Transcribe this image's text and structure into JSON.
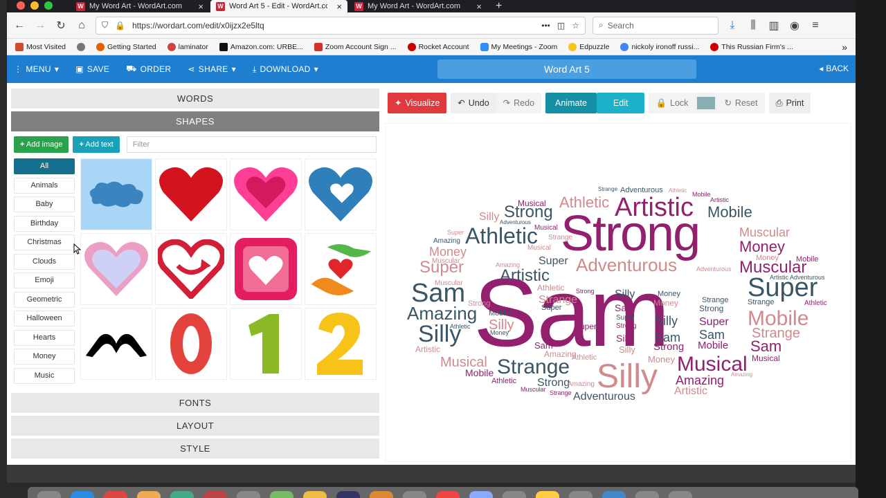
{
  "browser": {
    "tabs": [
      {
        "title": "My Word Art - WordArt.com"
      },
      {
        "title": "Word Art 5 - Edit - WordArt.co"
      },
      {
        "title": "My Word Art - WordArt.com"
      }
    ],
    "url": "https://wordart.com/edit/x0ijzx2e5ltq",
    "search_placeholder": "Search",
    "bookmarks": [
      "Most Visited",
      "Getting Started",
      "laminator",
      "Amazon.com: URBE...",
      "Zoom Account Sign ...",
      "Rocket Account",
      "My Meetings - Zoom",
      "Edpuzzle",
      "nickoly ironoff russi...",
      "This Russian Firm's ..."
    ]
  },
  "toolbar": {
    "menu": "MENU",
    "save": "SAVE",
    "order": "ORDER",
    "share": "SHARE",
    "download": "DOWNLOAD",
    "title": "Word Art 5",
    "back": "BACK"
  },
  "left": {
    "words": "WORDS",
    "shapes": "SHAPES",
    "add_image": "Add image",
    "add_text": "Add text",
    "filter_placeholder": "Filter",
    "categories": [
      "All",
      "Animals",
      "Baby",
      "Birthday",
      "Christmas",
      "Clouds",
      "Emoji",
      "Geometric",
      "Halloween",
      "Hearts",
      "Money",
      "Music"
    ],
    "fonts": "FONTS",
    "layout": "LAYOUT",
    "style": "STYLE"
  },
  "right": {
    "visualize": "Visualize",
    "undo": "Undo",
    "redo": "Redo",
    "animate": "Animate",
    "edit": "Edit",
    "lock": "Lock",
    "reset": "Reset",
    "print": "Print",
    "swatch_color": "#87aeb3"
  },
  "colors": {
    "accent": "#1e7fd0",
    "purple": "#92206e",
    "slate": "#3a5566",
    "pink": "#d08a8d"
  },
  "wordcloud": [
    [
      "Sam",
      684,
      500,
      140,
      "purple"
    ],
    [
      "Strong",
      810,
      362,
      72,
      "purple"
    ],
    [
      "Silly",
      862,
      560,
      48,
      "pink"
    ],
    [
      "Artistic",
      888,
      312,
      38,
      "purple"
    ],
    [
      "Athletic",
      672,
      352,
      32,
      "slate"
    ],
    [
      "Super",
      1080,
      428,
      38,
      "slate"
    ],
    [
      "Mobile",
      1080,
      470,
      30,
      "pink"
    ],
    [
      "Musical",
      978,
      536,
      30,
      "purple"
    ],
    [
      "Strange",
      718,
      540,
      30,
      "slate"
    ],
    [
      "Adventurous",
      832,
      392,
      26,
      "pink"
    ],
    [
      "Athletic",
      808,
      300,
      22,
      "pink"
    ],
    [
      "Strong",
      728,
      314,
      24,
      "slate"
    ],
    [
      "Mobile",
      1022,
      314,
      22,
      "slate"
    ],
    [
      "Muscular",
      1068,
      342,
      18,
      "pink"
    ],
    [
      "Money",
      1068,
      364,
      22,
      "purple"
    ],
    [
      "Muscular",
      1068,
      394,
      24,
      "purple"
    ],
    [
      "Sam",
      594,
      436,
      38,
      "slate"
    ],
    [
      "Amazing",
      588,
      462,
      26,
      "slate"
    ],
    [
      "Silly",
      604,
      494,
      34,
      "slate"
    ],
    [
      "Super",
      606,
      394,
      24,
      "pink"
    ],
    [
      "Money",
      620,
      370,
      18,
      "pink"
    ],
    [
      "Artistic",
      722,
      406,
      24,
      "slate"
    ],
    [
      "Musical",
      636,
      530,
      20,
      "pink"
    ],
    [
      "Strange",
      1086,
      488,
      20,
      "pink"
    ],
    [
      "Sam",
      1084,
      508,
      22,
      "purple"
    ],
    [
      "Amazing",
      976,
      556,
      18,
      "purple"
    ],
    [
      "Silly",
      692,
      318,
      16,
      "pink"
    ],
    [
      "Super",
      778,
      382,
      16,
      "slate"
    ],
    [
      "Strange",
      778,
      438,
      16,
      "pink"
    ],
    [
      "Silly",
      946,
      470,
      18,
      "slate"
    ],
    [
      "Sam",
      946,
      494,
      18,
      "slate"
    ],
    [
      "Super",
      1010,
      470,
      16,
      "purple"
    ],
    [
      "Sam",
      1010,
      490,
      18,
      "slate"
    ],
    [
      "Strong",
      776,
      558,
      16,
      "slate"
    ],
    [
      "Adventurous",
      828,
      578,
      16,
      "slate"
    ],
    [
      "Artistic",
      974,
      570,
      16,
      "pink"
    ],
    [
      "Mobile",
      706,
      456,
      11,
      "slate"
    ],
    [
      "Silly",
      706,
      476,
      20,
      "pink"
    ],
    [
      "Amazing",
      786,
      516,
      12,
      "pink"
    ],
    [
      "Super",
      830,
      476,
      12,
      "purple"
    ],
    [
      "Mobile",
      672,
      544,
      14,
      "purple"
    ],
    [
      "Athletic",
      710,
      554,
      11,
      "purple"
    ],
    [
      "Musical",
      1086,
      522,
      12,
      "purple"
    ],
    [
      "Strong",
      1010,
      450,
      12,
      "slate"
    ],
    [
      "Money",
      944,
      442,
      12,
      "pink"
    ],
    [
      "Strange",
      1080,
      440,
      11,
      "slate"
    ],
    [
      "Athletic",
      1162,
      441,
      10,
      "purple"
    ],
    [
      "Artistic Adventurous",
      1112,
      404,
      9,
      "slate"
    ],
    [
      "Mobile",
      1150,
      378,
      11,
      "purple"
    ],
    [
      "Money",
      1092,
      376,
      11,
      "pink"
    ],
    [
      "Adventurous",
      896,
      278,
      11,
      "slate"
    ],
    [
      "Strange",
      864,
      276,
      8,
      "slate"
    ],
    [
      "Athletic",
      966,
      278,
      8,
      "pink"
    ],
    [
      "Mobile",
      1000,
      284,
      9,
      "purple"
    ],
    [
      "Artistic",
      1026,
      292,
      9,
      "purple"
    ],
    [
      "Musical",
      748,
      298,
      12,
      "purple"
    ],
    [
      "Adventurous",
      722,
      324,
      8,
      "slate"
    ],
    [
      "Musical",
      772,
      332,
      10,
      "purple"
    ],
    [
      "Super",
      646,
      339,
      9,
      "pink"
    ],
    [
      "Amazing",
      626,
      351,
      10,
      "slate"
    ],
    [
      "Strange",
      792,
      346,
      10,
      "pink"
    ],
    [
      "Musical",
      762,
      361,
      10,
      "pink"
    ],
    [
      "Muscular",
      624,
      380,
      10,
      "pink"
    ],
    [
      "Amazing",
      716,
      386,
      9,
      "pink"
    ],
    [
      "Muscular",
      628,
      412,
      10,
      "pink"
    ],
    [
      "Athletic",
      776,
      420,
      12,
      "pink"
    ],
    [
      "Strong",
      832,
      424,
      9,
      "purple"
    ],
    [
      "Super",
      782,
      448,
      11,
      "slate"
    ],
    [
      "Strong",
      676,
      442,
      11,
      "pink"
    ],
    [
      "Athletic",
      650,
      475,
      9,
      "slate"
    ],
    [
      "Money",
      708,
      484,
      9,
      "slate"
    ],
    [
      "Artistic",
      600,
      509,
      12,
      "pink"
    ],
    [
      "Sam",
      772,
      504,
      13,
      "purple"
    ],
    [
      "Amazing",
      820,
      558,
      10,
      "pink"
    ],
    [
      "Muscular",
      752,
      566,
      9,
      "purple"
    ],
    [
      "Strange",
      794,
      571,
      9,
      "purple"
    ],
    [
      "Adventurous",
      1006,
      392,
      9,
      "pink"
    ],
    [
      "Silly",
      888,
      430,
      16,
      "slate"
    ],
    [
      "Sam",
      888,
      450,
      14,
      "purple"
    ],
    [
      "Super",
      890,
      462,
      10,
      "slate"
    ],
    [
      "Strong",
      890,
      474,
      10,
      "purple"
    ],
    [
      "Silly",
      890,
      494,
      14,
      "purple"
    ],
    [
      "Silly",
      894,
      510,
      13,
      "pink"
    ],
    [
      "Money",
      936,
      524,
      13,
      "pink"
    ],
    [
      "Money",
      950,
      428,
      11,
      "slate"
    ],
    [
      "Strange",
      1014,
      437,
      11,
      "slate"
    ],
    [
      "Mobile",
      1008,
      504,
      15,
      "purple"
    ],
    [
      "Strong",
      944,
      506,
      15,
      "purple"
    ],
    [
      "Athletic",
      826,
      520,
      11,
      "pink"
    ],
    [
      "Amazing",
      1056,
      544,
      8,
      "pink"
    ],
    [
      "Strange",
      1086,
      526,
      0,
      "pink"
    ]
  ]
}
